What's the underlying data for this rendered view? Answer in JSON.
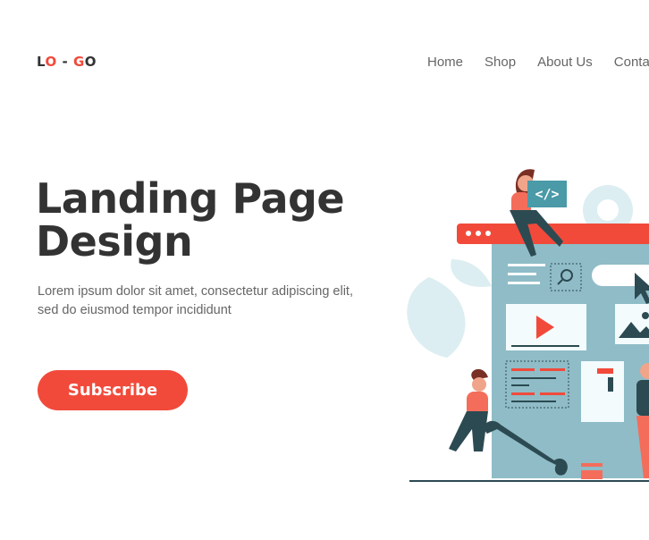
{
  "brand": {
    "logo_text_1": "L",
    "logo_text_2": "O",
    "logo_text_3": " - ",
    "logo_text_4": "G",
    "logo_text_5": "O"
  },
  "nav": {
    "items": [
      {
        "label": "Home"
      },
      {
        "label": "Shop"
      },
      {
        "label": "About Us"
      },
      {
        "label": "Conta"
      }
    ]
  },
  "hero": {
    "title_line1": "Landing Page",
    "title_line2": "Design",
    "description": "Lorem ipsum dolor sit amet, consectetur adipiscing elit, sed do eiusmod tempor incididunt",
    "cta_label": "Subscribe"
  },
  "illustration": {
    "code_icon": "</>"
  },
  "colors": {
    "accent": "#f14a3b",
    "teal": "#8fbcc7",
    "dark_teal": "#2c4a52",
    "text": "#333333"
  }
}
